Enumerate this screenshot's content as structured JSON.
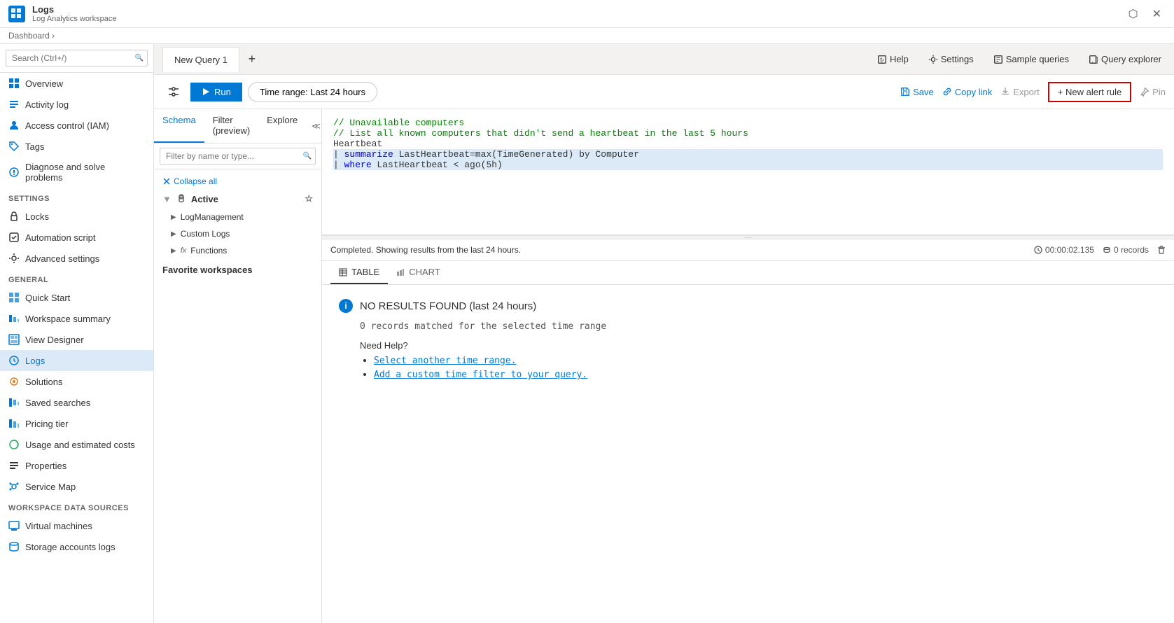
{
  "titleBar": {
    "logoText": "≡",
    "appName": "Logs",
    "appSubtitle": "Log Analytics workspace",
    "controls": [
      "⬡",
      "✕"
    ]
  },
  "breadcrumb": {
    "label": "Dashboard",
    "separator": "›"
  },
  "sidebar": {
    "searchPlaceholder": "Search (Ctrl+/)",
    "sections": [
      {
        "items": [
          {
            "label": "Overview",
            "icon": "overview"
          },
          {
            "label": "Activity log",
            "icon": "activity"
          },
          {
            "label": "Access control (IAM)",
            "icon": "iam"
          },
          {
            "label": "Tags",
            "icon": "tags"
          },
          {
            "label": "Diagnose and solve problems",
            "icon": "diagnose"
          }
        ]
      },
      {
        "header": "Settings",
        "items": [
          {
            "label": "Locks",
            "icon": "locks"
          },
          {
            "label": "Automation script",
            "icon": "automation"
          },
          {
            "label": "Advanced settings",
            "icon": "advanced"
          }
        ]
      },
      {
        "header": "General",
        "items": [
          {
            "label": "Quick Start",
            "icon": "quickstart"
          },
          {
            "label": "Workspace summary",
            "icon": "workspace-summary"
          },
          {
            "label": "View Designer",
            "icon": "view-designer"
          },
          {
            "label": "Logs",
            "icon": "logs",
            "active": true
          },
          {
            "label": "Solutions",
            "icon": "solutions"
          },
          {
            "label": "Saved searches",
            "icon": "saved-searches"
          },
          {
            "label": "Pricing tier",
            "icon": "pricing"
          },
          {
            "label": "Usage and estimated costs",
            "icon": "usage"
          },
          {
            "label": "Properties",
            "icon": "properties"
          },
          {
            "label": "Service Map",
            "icon": "service-map"
          }
        ]
      },
      {
        "header": "Workspace Data Sources",
        "items": [
          {
            "label": "Virtual machines",
            "icon": "vm"
          },
          {
            "label": "Storage accounts logs",
            "icon": "storage"
          }
        ]
      }
    ]
  },
  "tabs": [
    {
      "label": "New Query 1",
      "active": true
    }
  ],
  "tabBarActions": [
    {
      "label": "Help",
      "icon": "help"
    },
    {
      "label": "Settings",
      "icon": "settings"
    },
    {
      "label": "Sample queries",
      "icon": "sample-queries"
    },
    {
      "label": "Query explorer",
      "icon": "query-explorer"
    }
  ],
  "toolbar": {
    "runLabel": "Run",
    "timeRange": "Time range: Last 24 hours",
    "saveLabel": "Save",
    "copyLinkLabel": "Copy link",
    "exportLabel": "Export",
    "newAlertLabel": "+ New alert rule",
    "pinLabel": "Pin"
  },
  "schema": {
    "tabs": [
      {
        "label": "Schema",
        "active": true
      },
      {
        "label": "Filter (preview)"
      },
      {
        "label": "Explore"
      }
    ],
    "filterPlaceholder": "Filter by name or type...",
    "collapseAll": "Collapse all",
    "activeLabel": "Active",
    "items": [
      {
        "label": "LogManagement",
        "expandable": true
      },
      {
        "label": "Custom Logs",
        "expandable": true
      },
      {
        "label": "Functions",
        "prefix": "fx",
        "expandable": true
      }
    ],
    "favoriteWorkspaces": "Favorite workspaces"
  },
  "codeEditor": {
    "lines": [
      {
        "type": "comment",
        "text": "// Unavailable computers"
      },
      {
        "type": "comment",
        "text": "// List all known computers that didn't send a heartbeat in the last 5 hours"
      },
      {
        "type": "normal",
        "text": "Heartbeat"
      },
      {
        "type": "highlighted",
        "text": "| summarize LastHeartbeat=max(TimeGenerated) by Computer"
      },
      {
        "type": "highlighted",
        "text": "| where LastHeartbeat < ago(5h)"
      }
    ]
  },
  "results": {
    "statusText": "Completed. Showing results from the last 24 hours.",
    "durationLabel": "00:00:02.135",
    "recordsLabel": "0 records",
    "tabs": [
      {
        "label": "TABLE",
        "icon": "table",
        "active": true
      },
      {
        "label": "CHART",
        "icon": "chart"
      }
    ],
    "noResultsTitle": "NO RESULTS FOUND   (last 24 hours)",
    "noResultsSubtitle": "0 records matched for the selected time range",
    "helpTitle": "Need Help?",
    "helpLinks": [
      "Select another time range.",
      "Add a custom time filter to your query."
    ]
  }
}
